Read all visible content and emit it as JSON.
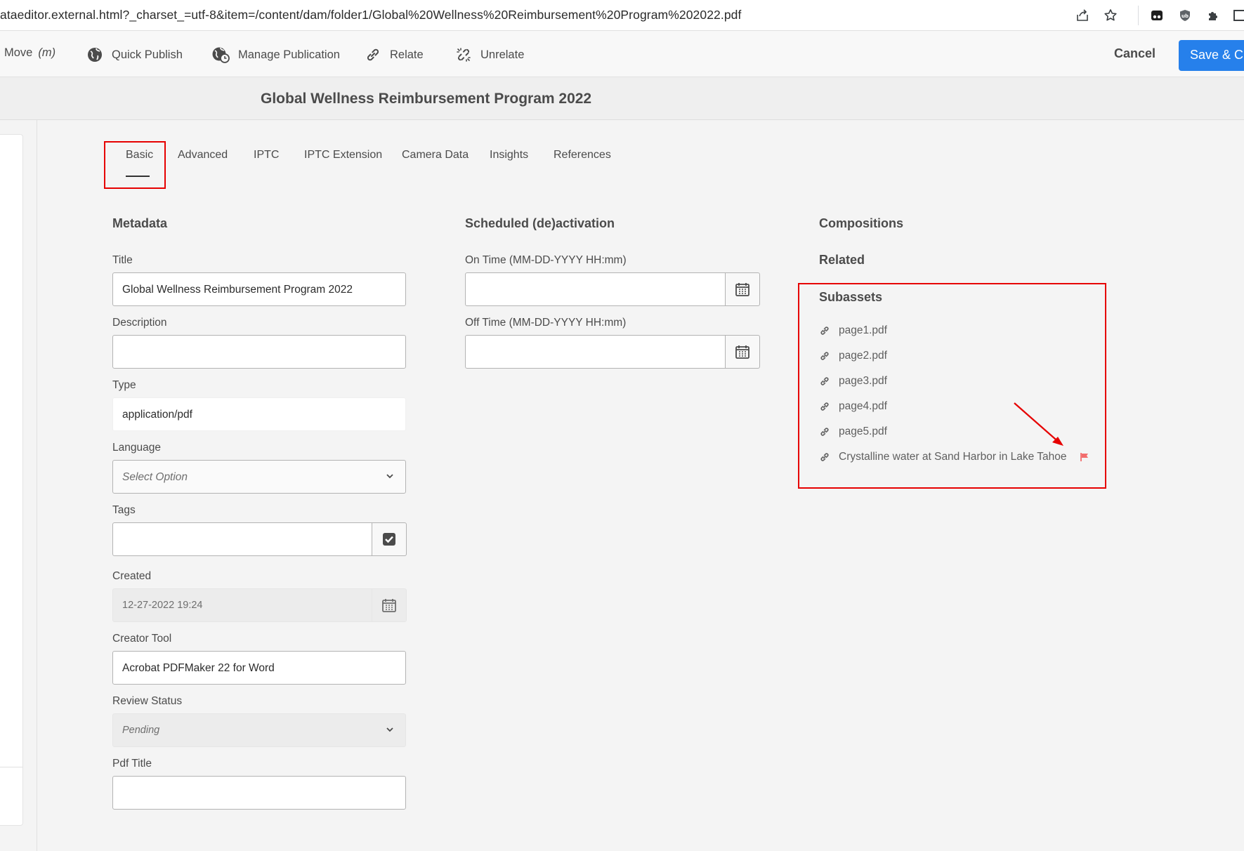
{
  "browser": {
    "url": "ataeditor.external.html?_charset_=utf-8&item=/content/dam/folder1/Global%20Wellness%20Reimbursement%20Program%202022.pdf",
    "icons": [
      "share-icon",
      "bookmark-star-icon",
      "extension-media-icon",
      "extension-shield-icon",
      "extensions-puzzle-icon",
      "window-icon"
    ]
  },
  "toolbar": {
    "move_label": "Move",
    "move_shortcut": "(m)",
    "quick_publish_label": "Quick Publish",
    "manage_publication_label": "Manage Publication",
    "relate_label": "Relate",
    "unrelate_label": "Unrelate",
    "cancel_label": "Cancel",
    "save_label": "Save & Close"
  },
  "header": {
    "title": "Global Wellness Reimbursement Program 2022"
  },
  "tabs": [
    {
      "label": "Basic",
      "active": true
    },
    {
      "label": "Advanced"
    },
    {
      "label": "IPTC"
    },
    {
      "label": "IPTC Extension"
    },
    {
      "label": "Camera Data"
    },
    {
      "label": "Insights"
    },
    {
      "label": "References"
    }
  ],
  "metadata": {
    "heading": "Metadata",
    "title_label": "Title",
    "title_value": "Global Wellness Reimbursement Program 2022",
    "description_label": "Description",
    "description_value": "",
    "type_label": "Type",
    "type_value": "application/pdf",
    "language_label": "Language",
    "language_value": "Select Option",
    "tags_label": "Tags",
    "tags_value": "",
    "created_label": "Created",
    "created_value": "12-27-2022 19:24",
    "creator_tool_label": "Creator Tool",
    "creator_tool_value": "Acrobat PDFMaker 22 for Word",
    "review_status_label": "Review Status",
    "review_status_value": "Pending",
    "pdf_title_label": "Pdf Title",
    "pdf_title_value": ""
  },
  "scheduled": {
    "heading": "Scheduled (de)activation",
    "on_time_label": "On Time (MM-DD-YYYY HH:mm)",
    "on_time_value": "",
    "off_time_label": "Off Time (MM-DD-YYYY HH:mm)",
    "off_time_value": ""
  },
  "right": {
    "compositions_heading": "Compositions",
    "related_heading": "Related",
    "subassets_heading": "Subassets",
    "subassets": [
      {
        "name": "page1.pdf"
      },
      {
        "name": "page2.pdf"
      },
      {
        "name": "page3.pdf"
      },
      {
        "name": "page4.pdf"
      },
      {
        "name": "page5.pdf"
      },
      {
        "name": "Crystalline water at Sand Harbor in Lake Tahoe",
        "flagged": true
      }
    ]
  },
  "colors": {
    "accent": "#2680eb",
    "annotation_red": "#e60000",
    "flag": "#f26d6d"
  }
}
